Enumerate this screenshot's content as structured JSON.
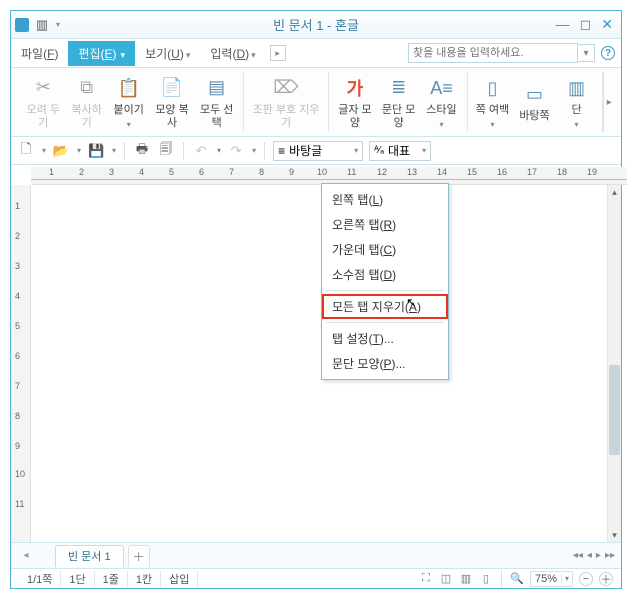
{
  "title": "빈 문서 1 - 혼글",
  "menus": {
    "file": "파일",
    "file_mn": "F",
    "edit": "편집",
    "edit_mn": "E",
    "view": "보기",
    "view_mn": "U",
    "input": "입력",
    "input_mn": "D"
  },
  "search_placeholder": "찾을 내용을 입력하세요.",
  "ribbon": {
    "undo": "오려\n두기",
    "copy": "복사하기",
    "paste": "붙이기",
    "shapecopy": "모양\n복사",
    "selectall": "모두\n선택",
    "protect": "조판 부호\n지우기",
    "charshape": "글자\n모양",
    "parashape": "문단\n모양",
    "style": "스타일",
    "page": "쪽\n여백",
    "landscape": "바탕쪽",
    "column": "단"
  },
  "combo": {
    "font": "바탕글",
    "preset": "대표",
    "font_icon": "≡"
  },
  "tabs": {
    "doc1": "빈 문서 1"
  },
  "context": {
    "left": "왼쪽 탭",
    "left_mn": "L",
    "right": "오른쪽 탭",
    "right_mn": "R",
    "center": "가운데 탭",
    "center_mn": "C",
    "decimal": "소수점 탭",
    "decimal_mn": "D",
    "clear": "모든 탭 지우기",
    "clear_mn": "A",
    "settings": "탭 설정",
    "settings_mn": "T",
    "para": "문단 모양",
    "para_mn": "P",
    "ellipsis": "..."
  },
  "status": {
    "page": "1/1쪽",
    "column": "1단",
    "line": "1줄",
    "col": "1칸",
    "mode": "삽입",
    "zoom": "75%"
  }
}
